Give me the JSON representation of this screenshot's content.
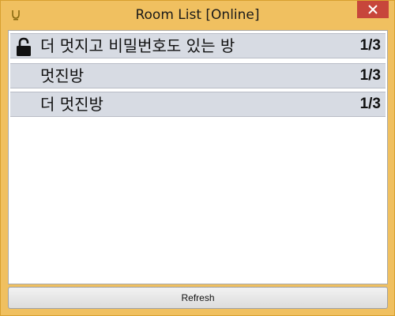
{
  "window": {
    "title": "Room List [Online]",
    "close_icon": "close-icon",
    "app_icon": "app-icon",
    "accent_color": "#f0c060",
    "close_color": "#c7463b"
  },
  "rooms": [
    {
      "name": "더 멋지고 비밀번호도 있는 방",
      "count": "1/3",
      "locked": true
    },
    {
      "name": "멋진방",
      "count": "1/3",
      "locked": false
    },
    {
      "name": "더 멋진방",
      "count": "1/3",
      "locked": false
    }
  ],
  "footer": {
    "refresh_label": "Refresh"
  }
}
